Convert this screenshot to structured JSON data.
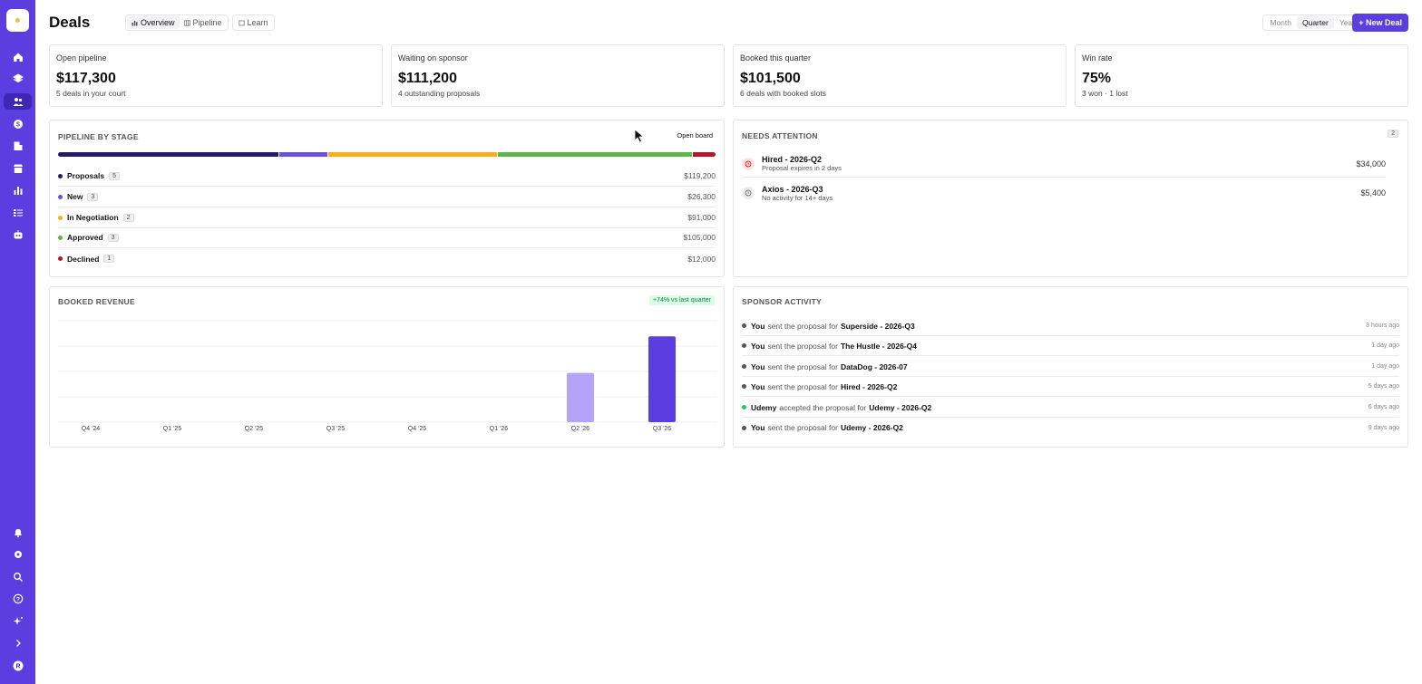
{
  "header": {
    "title": "Deals",
    "tabs": [
      {
        "label": "Overview"
      },
      {
        "label": "Pipeline"
      },
      {
        "label": "Learn"
      }
    ],
    "period_options": [
      "Month",
      "Quarter",
      "Year"
    ],
    "period_selected": "Quarter",
    "new_deal_label": "+ New Deal"
  },
  "stats": [
    {
      "label": "Open pipeline",
      "value": "$117,300",
      "sub": "5 deals in your court"
    },
    {
      "label": "Waiting on sponsor",
      "value": "$111,200",
      "sub": "4 outstanding proposals"
    },
    {
      "label": "Booked this quarter",
      "value": "$101,500",
      "sub": "6 deals with booked slots"
    },
    {
      "label": "Win rate",
      "value": "75%",
      "sub": "3 won · 1 lost"
    }
  ],
  "pipeline": {
    "title": "PIPELINE BY STAGE",
    "open_board": "Open board",
    "stages": [
      {
        "name": "Proposals",
        "count": "5",
        "amount": "$119,200",
        "color": "#221a6b"
      },
      {
        "name": "New",
        "count": "3",
        "amount": "$26,300",
        "color": "#6b4fd8"
      },
      {
        "name": "In Negotiation",
        "count": "2",
        "amount": "$91,000",
        "color": "#f5b019"
      },
      {
        "name": "Approved",
        "count": "3",
        "amount": "$105,000",
        "color": "#5db648"
      },
      {
        "name": "Declined",
        "count": "1",
        "amount": "$12,000",
        "color": "#b1182a"
      }
    ]
  },
  "attention": {
    "title": "NEEDS ATTENTION",
    "count": "2",
    "items": [
      {
        "name": "Hired - 2026-Q2",
        "sub": "Proposal expires in 2 days",
        "amount": "$34,000",
        "icon": "clock-alert-icon"
      },
      {
        "name": "Axios - 2026-Q3",
        "sub": "No activity for 14+ days",
        "amount": "$5,400",
        "icon": "history-icon"
      }
    ]
  },
  "revenue": {
    "title": "BOOKED REVENUE",
    "badge": "+74% vs last quarter"
  },
  "chart_data": {
    "type": "bar",
    "categories": [
      "Q4 '24",
      "Q1 '25",
      "Q2 '25",
      "Q3 '25",
      "Q4 '25",
      "Q1 '26",
      "Q2 '26",
      "Q3 '26"
    ],
    "values": [
      0,
      0,
      0,
      0,
      0,
      0,
      58300,
      101500
    ],
    "bar_colors": [
      "#5a3ee0",
      "#5a3ee0",
      "#5a3ee0",
      "#5a3ee0",
      "#5a3ee0",
      "#5a3ee0",
      "#b3a4f7",
      "#5a3ee0"
    ],
    "ylim": [
      0,
      120000
    ],
    "grid": true
  },
  "activity": {
    "title": "SPONSOR ACTIVITY",
    "items": [
      {
        "actor": "You",
        "verb": "sent the proposal for",
        "object": "Superside - 2026-Q3",
        "time": "3 hours ago",
        "color": "#555555"
      },
      {
        "actor": "You",
        "verb": "sent the proposal for",
        "object": "The Hustle - 2026-Q4",
        "time": "1 day ago",
        "color": "#555555"
      },
      {
        "actor": "You",
        "verb": "sent the proposal for",
        "object": "DataDog - 2026-07",
        "time": "1 day ago",
        "color": "#555555"
      },
      {
        "actor": "You",
        "verb": "sent the proposal for",
        "object": "Hired - 2026-Q2",
        "time": "5 days ago",
        "color": "#555555"
      },
      {
        "actor": "Udemy",
        "verb": "accepted the proposal for",
        "object": "Udemy - 2026-Q2",
        "time": "6 days ago",
        "color": "#22c55e"
      },
      {
        "actor": "You",
        "verb": "sent the proposal for",
        "object": "Udemy - 2026-Q2",
        "time": "9 days ago",
        "color": "#555555"
      }
    ]
  },
  "colors": {
    "accent": "#5a3ee0"
  }
}
